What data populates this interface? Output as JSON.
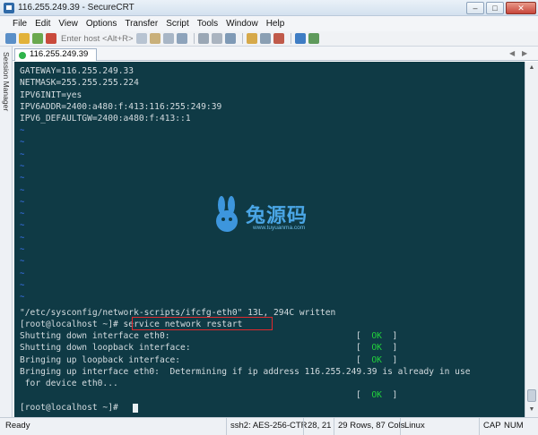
{
  "window": {
    "title": "116.255.249.39 - SecureCRT"
  },
  "menu": [
    "File",
    "Edit",
    "View",
    "Options",
    "Transfer",
    "Script",
    "Tools",
    "Window",
    "Help"
  ],
  "toolbar": {
    "host_placeholder": "Enter host <Alt+R>",
    "icons": [
      "connect-icon",
      "quick-connect-icon",
      "reconnect-icon",
      "disconnect-icon",
      "copy-icon",
      "paste-icon",
      "copy-paste-icon",
      "find-icon",
      "print-icon",
      "print-selection-icon",
      "tftp-icon",
      "session-options-icon",
      "keymap-icon",
      "script-icon",
      "help-icon",
      "sftp-icon"
    ]
  },
  "side": {
    "label": "Session Manager"
  },
  "tab": {
    "label": "116.255.249.39"
  },
  "terminal": {
    "config_lines": [
      "GATEWAY=116.255.249.33",
      "NETMASK=255.255.255.224",
      "IPV6INIT=yes",
      "IPV6ADDR=2400:a480:f:413:116:255:249:39",
      "IPV6_DEFAULTGW=2400:a480:f:413::1"
    ],
    "tilde": "~",
    "saved_msg": "\"/etc/sysconfig/network-scripts/ifcfg-eth0\" 13L, 294C written",
    "prompt": "[root@localhost ~]# ",
    "command": "service network restart",
    "output": [
      "Shutting down interface eth0:",
      "Shutting down loopback interface:",
      "Bringing up loopback interface:",
      "Bringing up interface eth0:  Determining if ip address 116.255.249.39 is already in use",
      " for device eth0..."
    ],
    "ok_open": "[  ",
    "ok": "OK",
    "ok_close": "  ]",
    "final_prompt": "[root@localhost ~]# "
  },
  "watermark": {
    "text": "兔源码",
    "url": "www.tuyuanma.com"
  },
  "status": {
    "ready": "Ready",
    "cipher": "ssh2: AES-256-CTR",
    "cursor": "28, 21",
    "size": "29 Rows, 87 Cols",
    "os": "Linux",
    "cap": "CAP",
    "num": "NUM"
  },
  "colors": {
    "terminal_bg": "#0f3a45",
    "tilde": "#3f77ff",
    "ok": "#22d23c",
    "highlight": "#e0292d"
  }
}
